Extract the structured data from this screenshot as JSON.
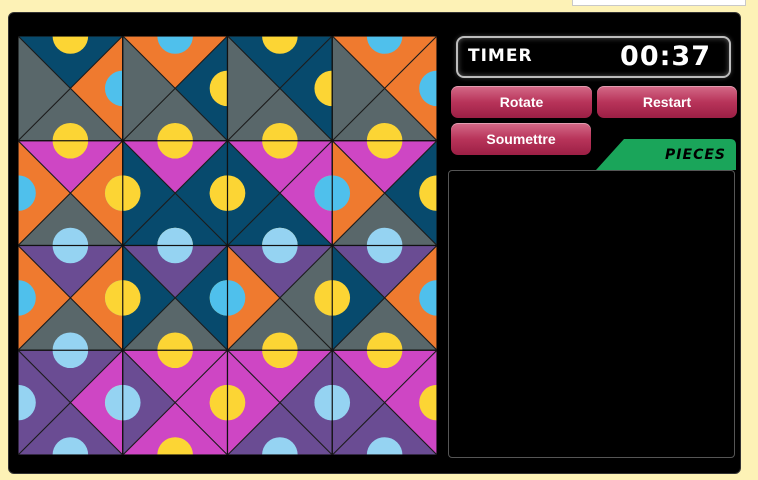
{
  "timer": {
    "label": "TIMER",
    "value": "00:37"
  },
  "buttons": {
    "rotate": "Rotate",
    "restart": "Restart",
    "submit": "Soumettre"
  },
  "pieces": {
    "label": "PIECES"
  },
  "colors": {
    "gray": "#59676a",
    "orange": "#ef7a2f",
    "navy": "#074a6d",
    "yellow": "#fcd534",
    "magenta": "#ce46c4",
    "lightblue": "#4fc0ec",
    "purple": "#6a4c93",
    "skyblue": "#95d3f2",
    "green": "#1aa55a",
    "button": "#b8345a"
  },
  "board": {
    "rows": 4,
    "cols": 4,
    "tiles": [
      [
        "navy",
        "orange",
        "gray",
        "gray"
      ],
      [
        "orange",
        "navy",
        "gray",
        "gray"
      ],
      [
        "navy",
        "navy",
        "gray",
        "gray"
      ],
      [
        "orange",
        "orange",
        "gray",
        "gray"
      ],
      [
        "magenta",
        "orange",
        "gray",
        "orange"
      ],
      [
        "magenta",
        "navy",
        "navy",
        "navy"
      ],
      [
        "magenta",
        "magenta",
        "navy",
        "navy"
      ],
      [
        "magenta",
        "navy",
        "gray",
        "orange"
      ],
      [
        "purple",
        "orange",
        "gray",
        "orange"
      ],
      [
        "purple",
        "navy",
        "gray",
        "navy"
      ],
      [
        "purple",
        "gray",
        "gray",
        "orange"
      ],
      [
        "purple",
        "orange",
        "gray",
        "navy"
      ],
      [
        "purple",
        "magenta",
        "purple",
        "purple"
      ],
      [
        "magenta",
        "magenta",
        "magenta",
        "purple"
      ],
      [
        "magenta",
        "purple",
        "purple",
        "magenta"
      ],
      [
        "magenta",
        "magenta",
        "purple",
        "purple"
      ]
    ]
  }
}
